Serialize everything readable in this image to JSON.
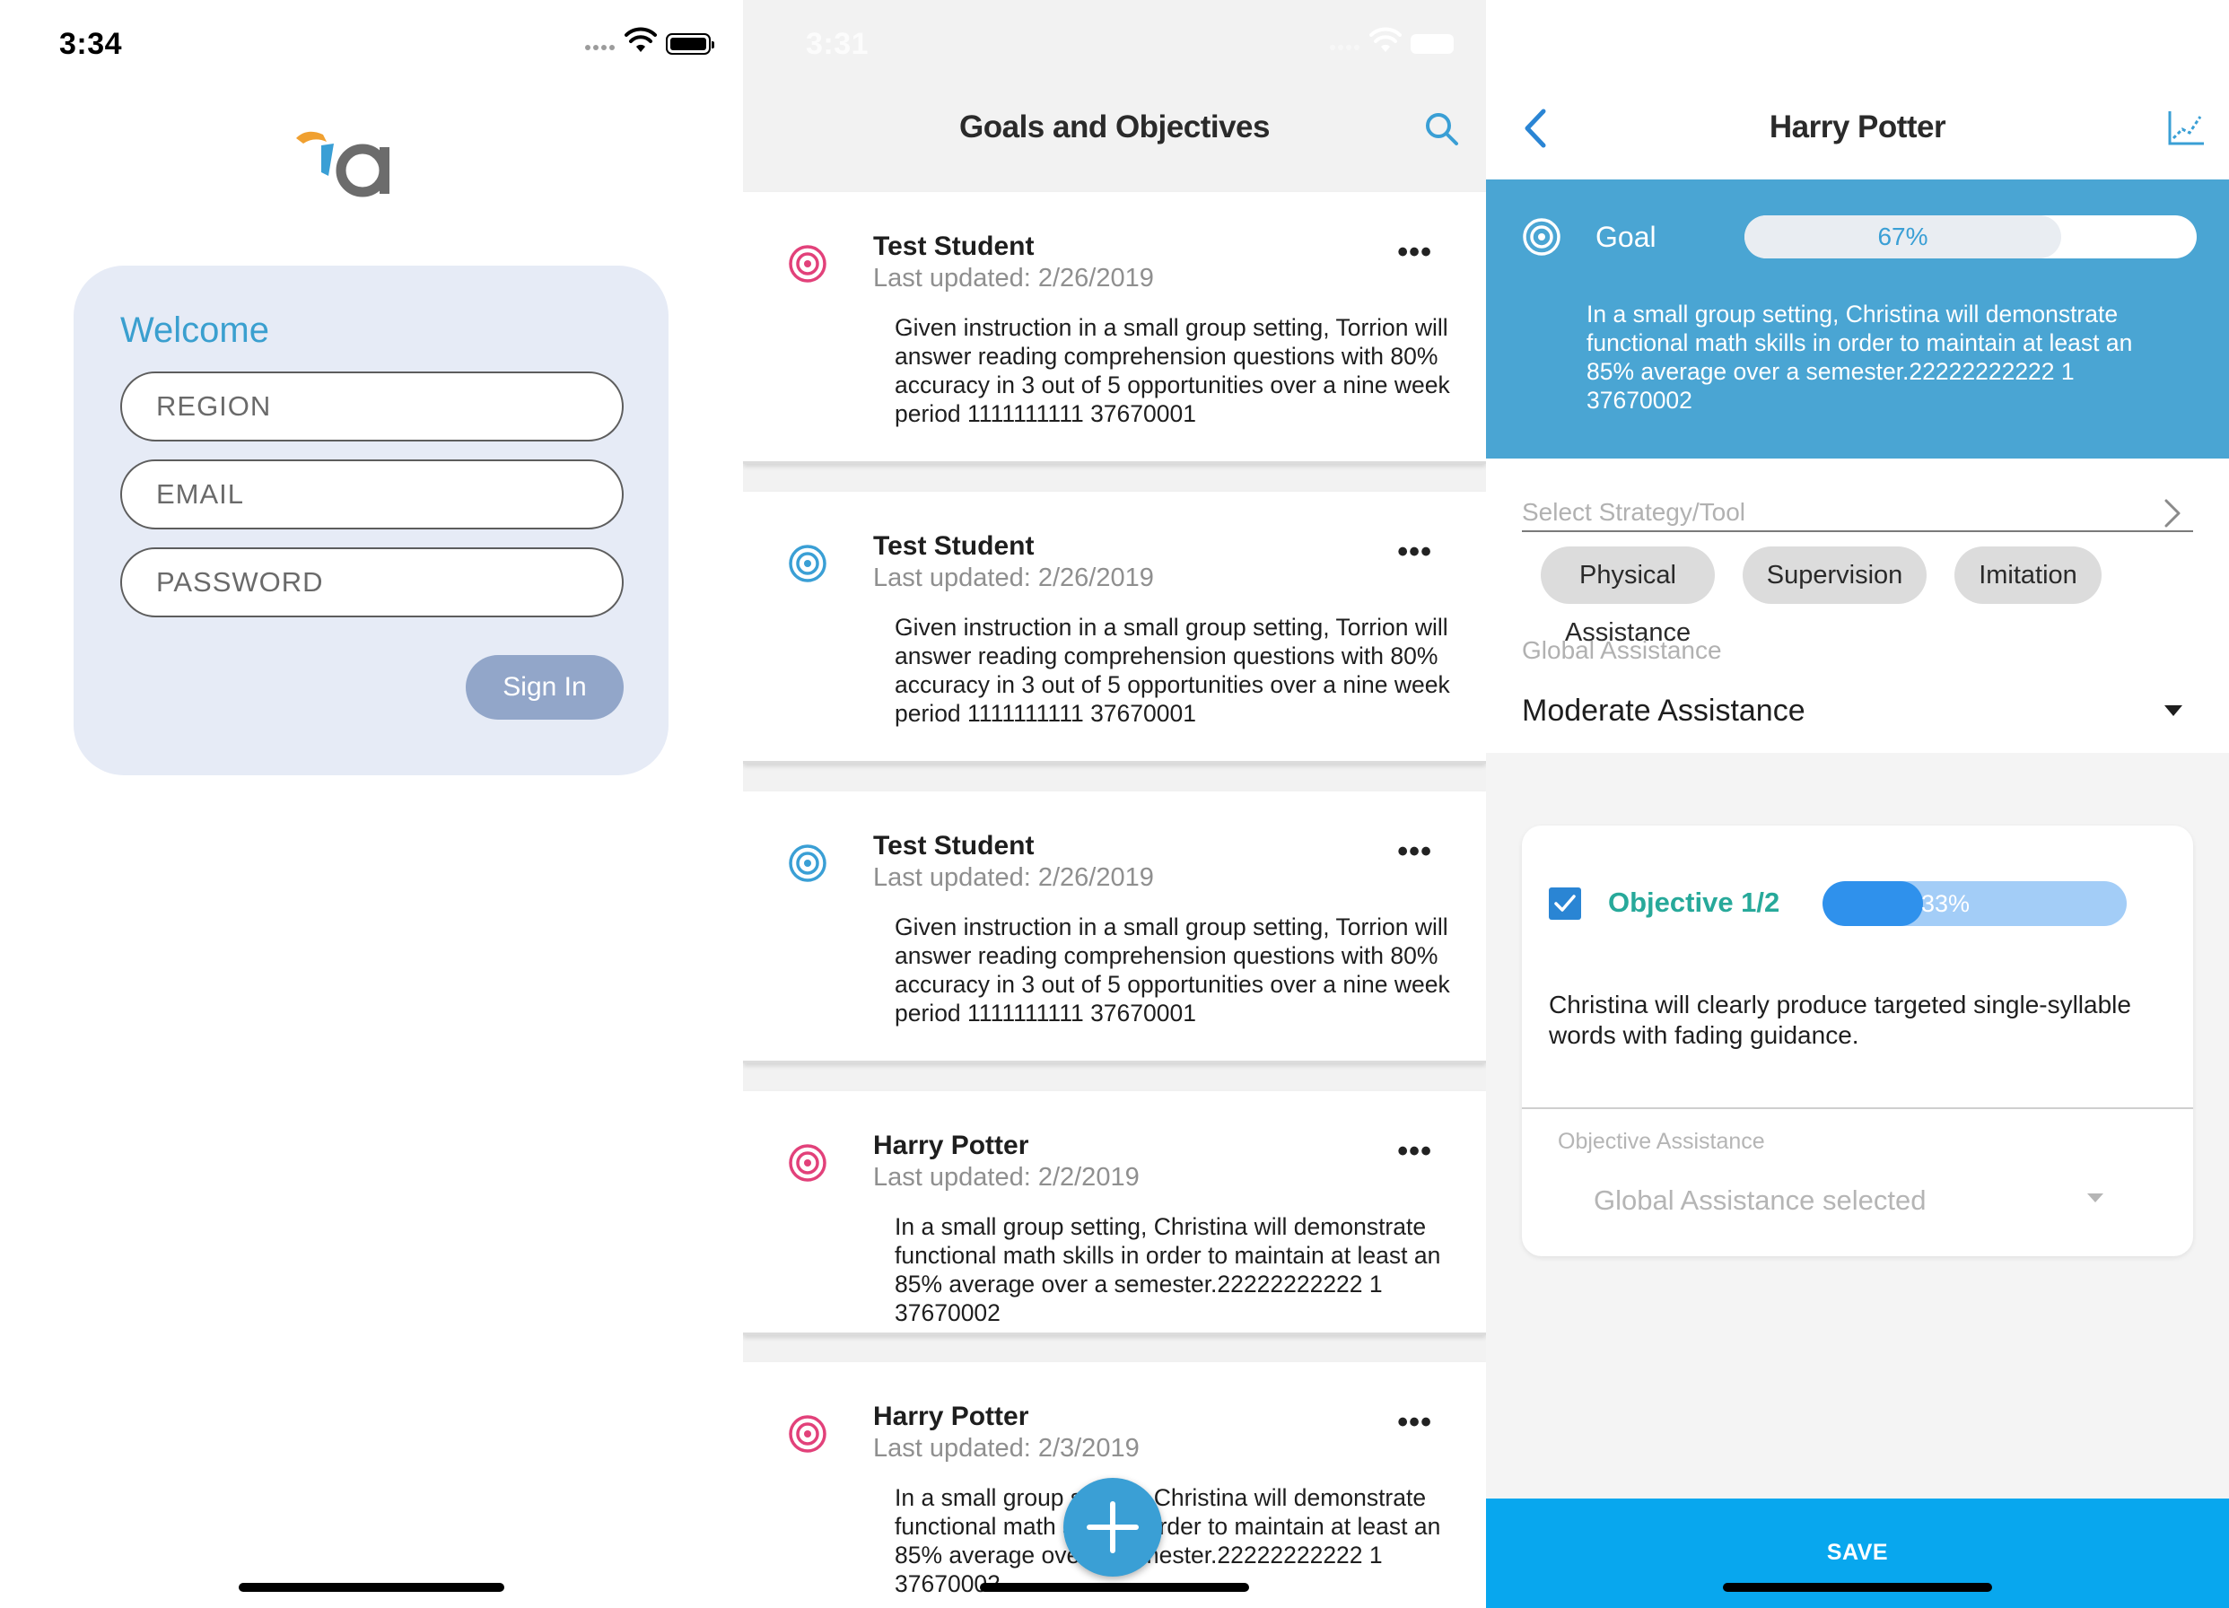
{
  "login": {
    "time": "3:34",
    "welcome": "Welcome",
    "region_placeholder": "REGION",
    "email_placeholder": "EMAIL",
    "password_placeholder": "PASSWORD",
    "signin_label": "Sign In",
    "brand_colors": {
      "orange": "#f0a030",
      "blue": "#3a9fd5",
      "gray": "#6c6c6c"
    }
  },
  "goals_list": {
    "time": "3:31",
    "title": "Goals and Objectives",
    "cards": [
      {
        "student": "Test Student",
        "updated": "Last updated: 2/26/2019",
        "icon_color": "#e2417a",
        "description": "Given instruction in a small group setting, Torrion will answer reading comprehension questions with 80% accuracy in 3 out of 5 opportunities over a nine week period 1111111111 37670001"
      },
      {
        "student": "Test Student",
        "updated": "Last updated: 2/26/2019",
        "icon_color": "#3a9fd5",
        "description": "Given instruction in a small group setting, Torrion will answer reading comprehension questions with 80% accuracy in 3 out of 5 opportunities over a nine week period 1111111111 37670001"
      },
      {
        "student": "Test Student",
        "updated": "Last updated: 2/26/2019",
        "icon_color": "#3a9fd5",
        "description": "Given instruction in a small group setting, Torrion will answer reading comprehension questions with 80% accuracy in 3 out of 5 opportunities over a nine week period 1111111111 37670001"
      },
      {
        "student": "Harry Potter",
        "updated": "Last updated: 2/2/2019",
        "icon_color": "#e2417a",
        "description": "In a small group setting, Christina will demonstrate functional math skills in order to maintain at least an 85% average over a semester.22222222222 1 37670002"
      },
      {
        "student": "Harry Potter",
        "updated": "Last updated: 2/3/2019",
        "icon_color": "#e2417a",
        "description": "In a small group setting, Christina will demonstrate functional math skills in order to maintain at least an 85% average over a semester.22222222222 1 37670002"
      }
    ]
  },
  "detail": {
    "title": "Harry Potter",
    "goal_label": "Goal",
    "goal_percent_text": "67%",
    "goal_progress": 0.7,
    "goal_description": "In a small group setting, Christina will demonstrate functional math skills in order to maintain at least an 85% average over a semester.22222222222 1 37670002",
    "strategy_placeholder": "Select Strategy/Tool",
    "strategy_chips": [
      "Physical Assistance",
      "Supervision",
      "Imitation"
    ],
    "global_assistance_label": "Global Assistance",
    "global_assistance_value": "Moderate Assistance",
    "objective_title": "Objective 1/2",
    "objective_percent_text": "33%",
    "objective_progress": 0.33,
    "objective_description": "Christina will clearly produce targeted single-syllable words with fading guidance.",
    "objective_assistance_label": "Objective Assistance",
    "objective_assistance_value": "Global Assistance selected",
    "save_label": "SAVE",
    "accent_color": "#4aa5d3",
    "save_color": "#08a7ee",
    "objective_color": "#27a99a"
  }
}
